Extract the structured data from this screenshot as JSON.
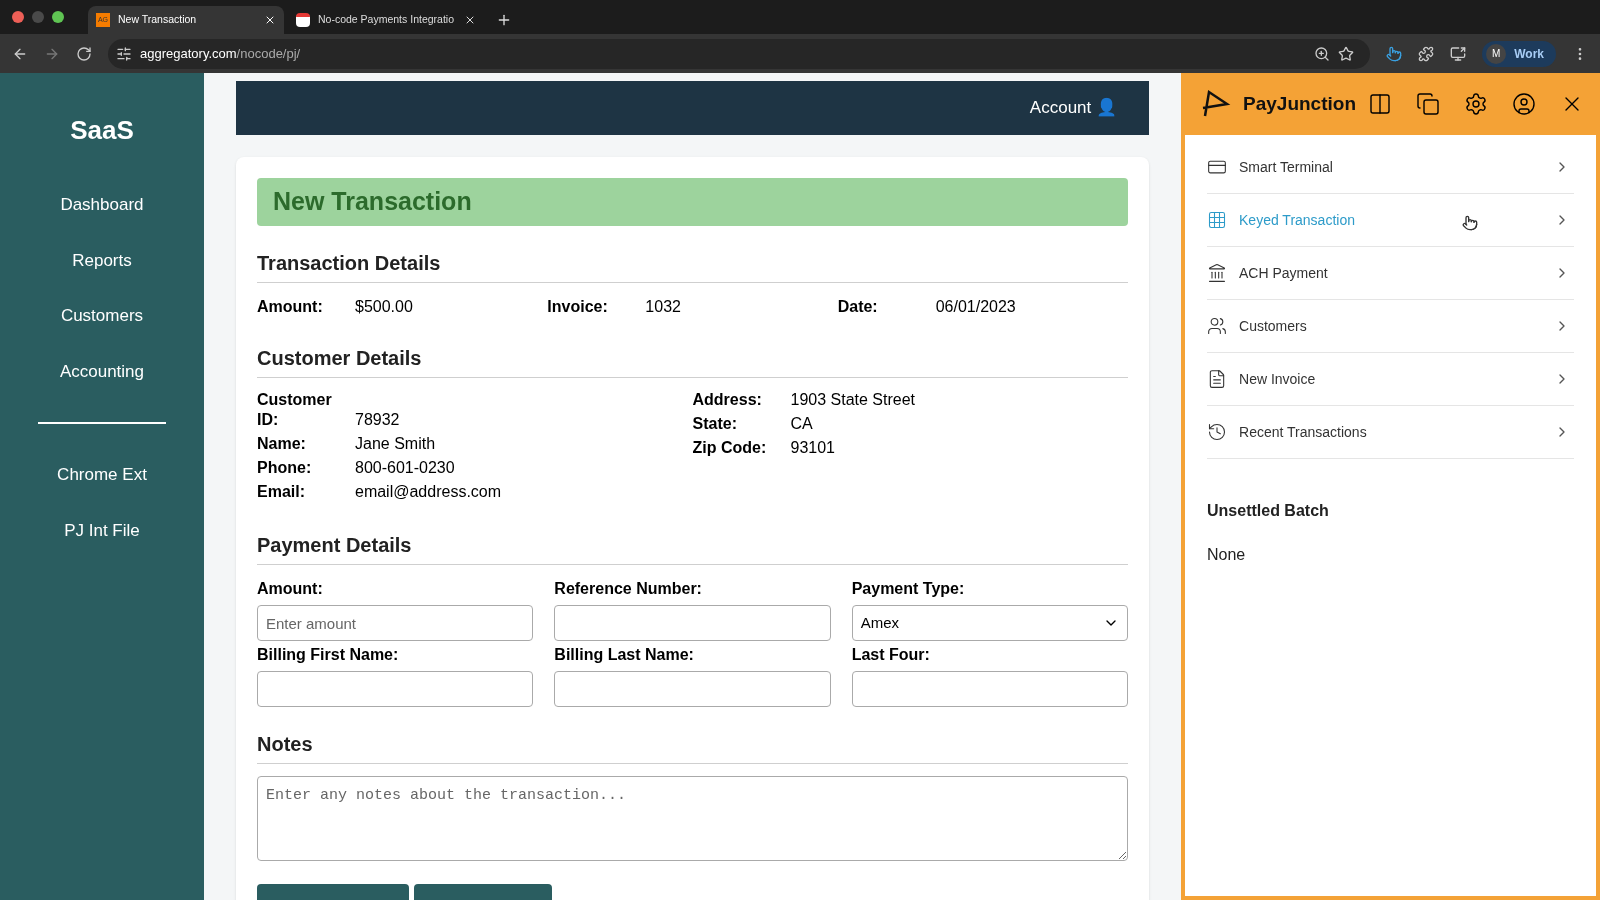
{
  "browser": {
    "tabs": [
      {
        "title": "New Transaction",
        "favicon": "AG",
        "selected": true
      },
      {
        "title": "No-code Payments Integratio",
        "selected": false
      }
    ],
    "url_host": "aggregatory.com",
    "url_path": "/nocode/pj/",
    "profile": {
      "initial": "M",
      "name": "Work"
    }
  },
  "sidebar": {
    "logo": "SaaS",
    "items": [
      {
        "label": "Dashboard"
      },
      {
        "label": "Reports"
      },
      {
        "label": "Customers"
      },
      {
        "label": "Accounting"
      }
    ],
    "items_below_divider": [
      {
        "label": "Chrome Ext"
      },
      {
        "label": "PJ Int File"
      }
    ]
  },
  "header": {
    "account": "Account 👤"
  },
  "form": {
    "title": "New Transaction",
    "transaction_details": {
      "heading": "Transaction Details",
      "fields": [
        {
          "label": "Amount:",
          "value": "$500.00"
        },
        {
          "label": "Invoice:",
          "value": "1032"
        },
        {
          "label": "Date:",
          "value": "06/01/2023"
        }
      ]
    },
    "customer_details": {
      "heading": "Customer Details",
      "left": [
        {
          "label": "Customer ID:",
          "value": "78932"
        },
        {
          "label": "Name:",
          "value": "Jane Smith"
        },
        {
          "label": "Phone:",
          "value": "800-601-0230"
        },
        {
          "label": "Email:",
          "value": "email@address.com"
        }
      ],
      "right": [
        {
          "label": "Address:",
          "value": "1903 State Street"
        },
        {
          "label": "State:",
          "value": "CA"
        },
        {
          "label": "Zip Code:",
          "value": "93101"
        }
      ]
    },
    "payment_details": {
      "heading": "Payment Details",
      "fields": [
        {
          "kind": "input",
          "label": "Amount:",
          "placeholder": "Enter amount"
        },
        {
          "kind": "input",
          "label": "Reference Number:"
        },
        {
          "kind": "select",
          "label": "Payment Type:",
          "value": "Amex"
        },
        {
          "kind": "input",
          "label": "Billing First Name:"
        },
        {
          "kind": "input",
          "label": "Billing Last Name:"
        },
        {
          "kind": "input",
          "label": "Last Four:"
        }
      ]
    },
    "notes": {
      "heading": "Notes",
      "placeholder": "Enter any notes about the transaction..."
    }
  },
  "extension": {
    "brand": "PayJunction",
    "items": [
      {
        "label": "Smart Terminal",
        "selected": false
      },
      {
        "label": "Keyed Transaction",
        "selected": true
      },
      {
        "label": "ACH Payment",
        "selected": false
      },
      {
        "label": "Customers",
        "selected": false
      },
      {
        "label": "New Invoice",
        "selected": false
      },
      {
        "label": "Recent Transactions",
        "selected": false
      }
    ],
    "batch": {
      "heading": "Unsettled Batch",
      "value": "None"
    }
  }
}
